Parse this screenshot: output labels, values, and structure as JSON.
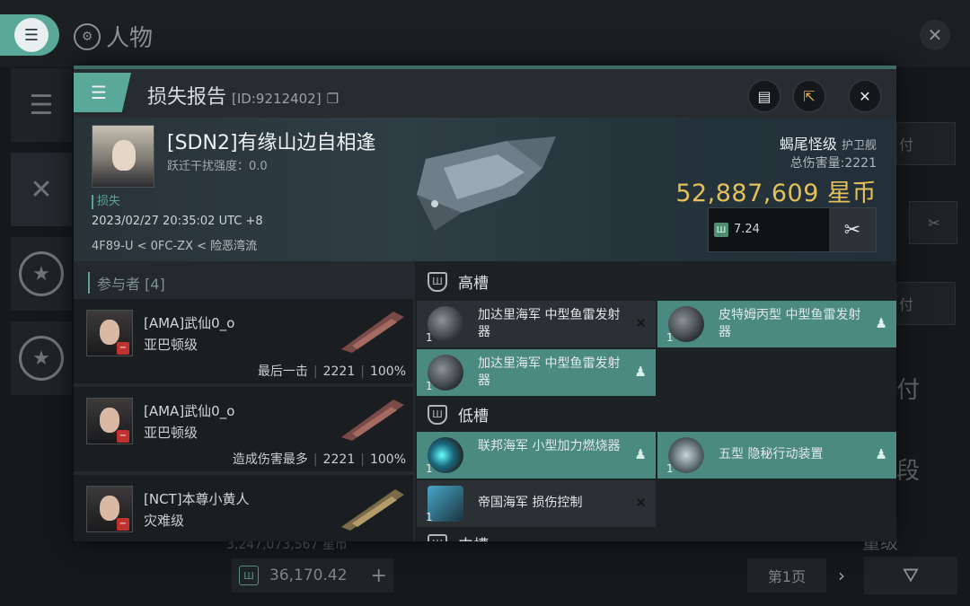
{
  "background": {
    "title": "人物",
    "right_labels": [
      "付",
      "付",
      "付",
      "段",
      "量级"
    ],
    "under_value": "3,247,073,567 星币",
    "isk": "36,170.42",
    "page": "第1页"
  },
  "modal": {
    "title": "损失报告",
    "id": "[ID:9212402]",
    "victim": {
      "name": "[SDN2]有缘山边自相逢",
      "jam_label": "跃迁干扰强度：0.0",
      "lost_tag": "损失",
      "datetime": "2023/02/27 20:35:02 UTC +8",
      "location": "4F89-U < 0FC-ZX < 险恶湾流"
    },
    "ship": {
      "name": "蝎尾怪级",
      "class": "护卫舰",
      "total_damage_label": "总伤害量:",
      "total_damage": "2221",
      "value": "52,887,609 星币",
      "security": "7.24"
    },
    "participants": {
      "header": "参与者 [4]",
      "rows": [
        {
          "name": "[AMA]武仙0_o",
          "ship": "亚巴顿级",
          "tag": "最后一击",
          "damage": "2221",
          "pct": "100%"
        },
        {
          "name": "[AMA]武仙0_o",
          "ship": "亚巴顿级",
          "tag": "造成伤害最多",
          "damage": "2221",
          "pct": "100%"
        },
        {
          "name": "[NCT]本尊小黄人",
          "ship": "灾难级"
        }
      ]
    },
    "slots": {
      "high": {
        "label": "高槽",
        "modules": [
          {
            "name": "加达里海军 中型鱼雷发射器",
            "qty": "1",
            "state": "destroyed"
          },
          {
            "name": "皮特姆丙型 中型鱼雷发射器",
            "qty": "1",
            "state": "dropped"
          },
          {
            "name": "加达里海军 中型鱼雷发射器",
            "qty": "1",
            "state": "dropped"
          }
        ]
      },
      "low": {
        "label": "低槽",
        "modules": [
          {
            "name": "联邦海军 小型加力燃烧器",
            "qty": "1",
            "state": "dropped"
          },
          {
            "name": "五型 隐秘行动装置",
            "qty": "1",
            "state": "dropped"
          },
          {
            "name": "帝国海军 损伤控制",
            "qty": "1",
            "state": "destroyed"
          }
        ]
      },
      "mid_partial": "中槽"
    }
  }
}
